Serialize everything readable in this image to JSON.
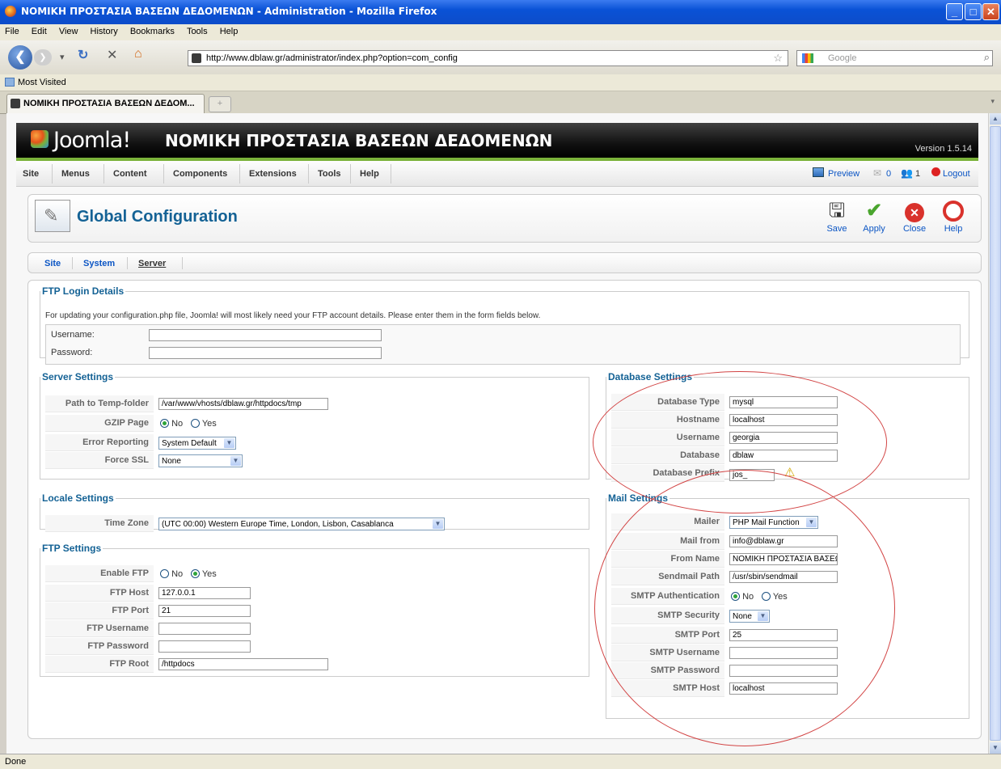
{
  "window": {
    "title": "ΝΟΜΙΚΗ ΠΡΟΣΤΑΣΙΑ ΒΑΣΕΩΝ ΔΕΔΟΜΕΝΩΝ - Administration - Mozilla Firefox",
    "min": "_",
    "max": "□",
    "close": "✕"
  },
  "menu": [
    "File",
    "Edit",
    "View",
    "History",
    "Bookmarks",
    "Tools",
    "Help"
  ],
  "nav": {
    "url": "http://www.dblaw.gr/administrator/index.php?option=com_config",
    "search_placeholder": "Google"
  },
  "bookmarks": {
    "most_visited": "Most Visited"
  },
  "tab": {
    "label": "ΝΟΜΙΚΗ ΠΡΟΣΤΑΣΙΑ ΒΑΣΕΩΝ ΔΕΔΟΜ...",
    "new": "+"
  },
  "status": "Done",
  "joomla": {
    "logo": "Joomla!",
    "site_title": "ΝΟΜΙΚΗ ΠΡΟΣΤΑΣΙΑ ΒΑΣΕΩΝ ΔΕΔΟΜΕΝΩΝ",
    "version": "Version 1.5.14",
    "menu": [
      "Site",
      "Menus",
      "Content",
      "Components",
      "Extensions",
      "Tools",
      "Help"
    ],
    "preview": "Preview",
    "messages_count": "0",
    "users_count": "1",
    "logout": "Logout"
  },
  "toolbar": {
    "page_title": "Global Configuration",
    "save": "Save",
    "apply": "Apply",
    "close": "Close",
    "help": "Help"
  },
  "submenu": {
    "site": "Site",
    "system": "System",
    "server": "Server"
  },
  "ftp_login": {
    "legend": "FTP Login Details",
    "intro": "For updating your configuration.php file, Joomla! will most likely need your FTP account details. Please enter them in the form fields below.",
    "username_label": "Username:",
    "username": "",
    "password_label": "Password:",
    "password": ""
  },
  "server_settings": {
    "legend": "Server Settings",
    "temp_label": "Path to Temp-folder",
    "temp": "/var/www/vhosts/dblaw.gr/httpdocs/tmp",
    "gzip_label": "GZIP Page Compression",
    "error_label": "Error Reporting",
    "error": "System Default",
    "ssl_label": "Force SSL",
    "ssl": "None"
  },
  "radio": {
    "no": "No",
    "yes": "Yes"
  },
  "locale": {
    "legend": "Locale Settings",
    "tz_label": "Time Zone",
    "tz": "(UTC 00:00) Western Europe Time, London, Lisbon, Casablanca"
  },
  "ftp_settings": {
    "legend": "FTP Settings",
    "enable_label": "Enable FTP",
    "host_label": "FTP Host",
    "host": "127.0.0.1",
    "port_label": "FTP Port",
    "port": "21",
    "user_label": "FTP Username",
    "user": "",
    "pass_label": "FTP Password",
    "pass": "",
    "root_label": "FTP Root",
    "root": "/httpdocs"
  },
  "database": {
    "legend": "Database Settings",
    "type_label": "Database Type",
    "type": "mysql",
    "host_label": "Hostname",
    "host": "localhost",
    "user_label": "Username",
    "user": "georgia",
    "db_label": "Database",
    "db": "dblaw",
    "prefix_label": "Database Prefix",
    "prefix": "jos_"
  },
  "mail": {
    "legend": "Mail Settings",
    "mailer_label": "Mailer",
    "mailer": "PHP Mail Function",
    "from_label": "Mail from",
    "from": "info@dblaw.gr",
    "name_label": "From Name",
    "name": "ΝΟΜΙΚΗ ΠΡΟΣΤΑΣΙΑ ΒΑΣΕΩ",
    "sendmail_label": "Sendmail Path",
    "sendmail": "/usr/sbin/sendmail",
    "smtp_auth_label": "SMTP Authentication",
    "smtp_sec_label": "SMTP Security",
    "smtp_sec": "None",
    "smtp_port_label": "SMTP Port",
    "smtp_port": "25",
    "smtp_user_label": "SMTP Username",
    "smtp_user": "",
    "smtp_pass_label": "SMTP Password",
    "smtp_pass": "",
    "smtp_host_label": "SMTP Host",
    "smtp_host": "localhost"
  },
  "colors": {
    "joomla_green": "#7ab23a",
    "legend_blue": "#146295",
    "annotation_red": "#d24444"
  }
}
